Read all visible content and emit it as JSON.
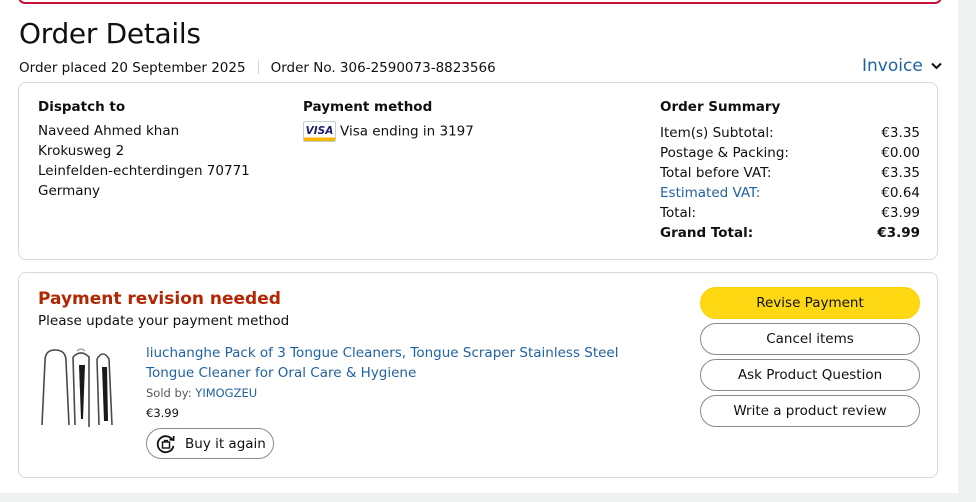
{
  "page": {
    "title": "Order Details",
    "order_placed": "Order placed 20 September 2025",
    "order_number": "Order No. 306-2590073-8823566",
    "invoice_label": "Invoice"
  },
  "dispatch": {
    "heading": "Dispatch to",
    "lines": [
      "Naveed Ahmed khan",
      "Krokusweg 2",
      "Leinfelden-echterdingen 70771",
      "Germany"
    ]
  },
  "payment": {
    "heading": "Payment method",
    "card_brand": "VISA",
    "card_text": "Visa ending in 3197"
  },
  "summary": {
    "heading": "Order Summary",
    "rows": [
      {
        "label": "Item(s) Subtotal:",
        "value": "€3.35"
      },
      {
        "label": "Postage & Packing:",
        "value": "€0.00"
      },
      {
        "label": "Total before VAT:",
        "value": "€3.35"
      },
      {
        "label": "Estimated VAT:",
        "value": "€0.64"
      },
      {
        "label": "Total:",
        "value": "€3.99"
      },
      {
        "label": "Grand Total:",
        "value": "€3.99"
      }
    ]
  },
  "revision": {
    "title": "Payment revision needed",
    "subtitle": "Please update your payment method"
  },
  "product": {
    "title": "liuchanghe Pack of 3 Tongue Cleaners, Tongue Scraper Stainless Steel Tongue Cleaner for Oral Care & Hygiene",
    "sold_by_label": "Sold by:",
    "seller": "YIMOGZEU",
    "price": "€3.99",
    "buy_again": "Buy it again"
  },
  "actions": {
    "revise_payment": "Revise Payment",
    "cancel_items": "Cancel items",
    "ask_question": "Ask Product Question",
    "write_review": "Write a product review"
  },
  "colors": {
    "link": "#2162a1",
    "alert": "#b12704",
    "primary_button": "#ffd814",
    "top_border": "#cc0c39"
  }
}
